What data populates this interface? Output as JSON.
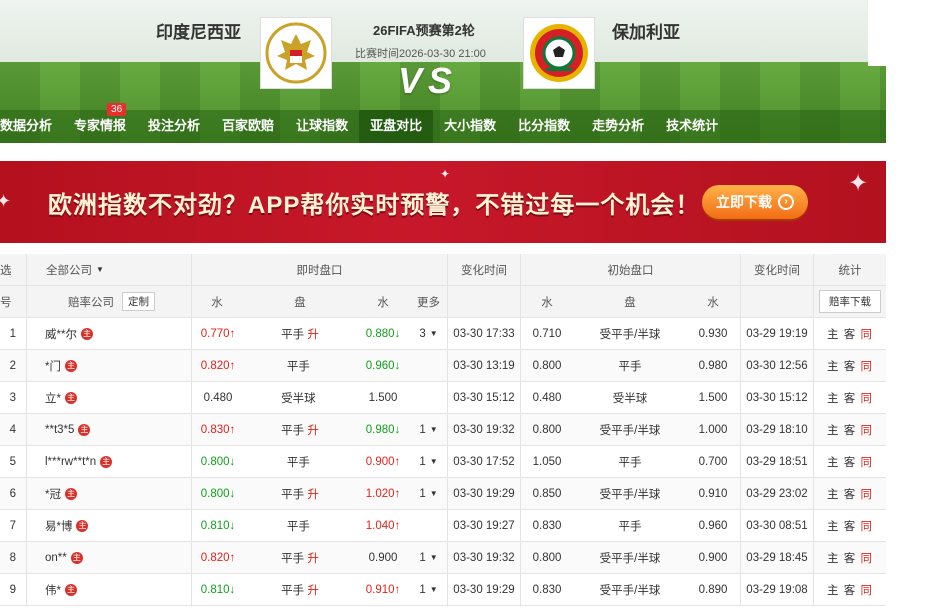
{
  "header": {
    "home_team": "印度尼西亚",
    "away_team": "保加利亚",
    "match_title": "26FIFA预赛第2轮",
    "match_time": "比赛时间2026-03-30 21:00",
    "vs": "VS"
  },
  "nav": {
    "items": [
      "数据分析",
      "专家情报",
      "投注分析",
      "百家欧赔",
      "让球指数",
      "亚盘对比",
      "大小指数",
      "比分指数",
      "走势分析",
      "技术统计"
    ],
    "badge": "36",
    "active_index": 5
  },
  "banner": {
    "text": "欧洲指数不对劲？APP帮你实时预警，不错过每一个机会！",
    "button": "立即下载"
  },
  "table": {
    "header1": {
      "select": "选",
      "company": "全部公司",
      "live": "即时盘口",
      "change_time": "变化时间",
      "initial": "初始盘口",
      "change_time2": "变化时间",
      "stats": "统计"
    },
    "header2": {
      "no": "号",
      "company": "赔率公司",
      "custom": "定制",
      "water": "水",
      "line": "盘",
      "water2": "水",
      "more": "更多",
      "i_water": "水",
      "i_line": "盘",
      "i_water2": "水",
      "download": "赔率下载"
    },
    "host_badge": "主",
    "stat_labels": [
      "主",
      "客",
      "同"
    ],
    "rows": [
      {
        "no": "1",
        "company": "威**尔",
        "w1": "0.770↑",
        "w1c": "red",
        "line": "平手",
        "up": "升",
        "w2": "0.880↓",
        "w2c": "green",
        "more": "3",
        "time": "03-30 17:33",
        "iw1": "0.710",
        "iline": "受平手/半球",
        "iw2": "0.930",
        "itime": "03-29 19:19"
      },
      {
        "no": "2",
        "company": "*门",
        "w1": "0.820↑",
        "w1c": "red",
        "line": "平手",
        "up": "",
        "w2": "0.960↓",
        "w2c": "green",
        "more": "",
        "time": "03-30 13:19",
        "iw1": "0.800",
        "iline": "平手",
        "iw2": "0.980",
        "itime": "03-30 12:56"
      },
      {
        "no": "3",
        "company": "立*",
        "w1": "0.480",
        "w1c": "gray",
        "line": "受半球",
        "up": "",
        "w2": "1.500",
        "w2c": "gray",
        "more": "",
        "time": "03-30 15:12",
        "iw1": "0.480",
        "iline": "受半球",
        "iw2": "1.500",
        "itime": "03-30 15:12"
      },
      {
        "no": "4",
        "company": "**t3*5",
        "w1": "0.830↑",
        "w1c": "red",
        "line": "平手",
        "up": "升",
        "w2": "0.980↓",
        "w2c": "green",
        "more": "1",
        "time": "03-30 19:32",
        "iw1": "0.800",
        "iline": "受平手/半球",
        "iw2": "1.000",
        "itime": "03-29 18:10"
      },
      {
        "no": "5",
        "company": "l***rw**t*n",
        "w1": "0.800↓",
        "w1c": "green",
        "line": "平手",
        "up": "",
        "w2": "0.900↑",
        "w2c": "red",
        "more": "1",
        "time": "03-30 17:52",
        "iw1": "1.050",
        "iline": "平手",
        "iw2": "0.700",
        "itime": "03-29 18:51"
      },
      {
        "no": "6",
        "company": "*冠",
        "w1": "0.800↓",
        "w1c": "green",
        "line": "平手",
        "up": "升",
        "w2": "1.020↑",
        "w2c": "red",
        "more": "1",
        "time": "03-30 19:29",
        "iw1": "0.850",
        "iline": "受平手/半球",
        "iw2": "0.910",
        "itime": "03-29 23:02"
      },
      {
        "no": "7",
        "company": "易*博",
        "w1": "0.810↓",
        "w1c": "green",
        "line": "平手",
        "up": "",
        "w2": "1.040↑",
        "w2c": "red",
        "more": "",
        "time": "03-30 19:27",
        "iw1": "0.830",
        "iline": "平手",
        "iw2": "0.960",
        "itime": "03-30 08:51"
      },
      {
        "no": "8",
        "company": "on**",
        "w1": "0.820↑",
        "w1c": "red",
        "line": "平手",
        "up": "升",
        "w2": "0.900",
        "w2c": "gray",
        "more": "1",
        "time": "03-30 19:32",
        "iw1": "0.800",
        "iline": "受平手/半球",
        "iw2": "0.900",
        "itime": "03-29 18:45"
      },
      {
        "no": "9",
        "company": "伟*",
        "w1": "0.810↓",
        "w1c": "green",
        "line": "平手",
        "up": "升",
        "w2": "0.910↑",
        "w2c": "red",
        "more": "1",
        "time": "03-30 19:29",
        "iw1": "0.830",
        "iline": "受平手/半球",
        "iw2": "0.890",
        "itime": "03-29 19:08"
      }
    ]
  }
}
